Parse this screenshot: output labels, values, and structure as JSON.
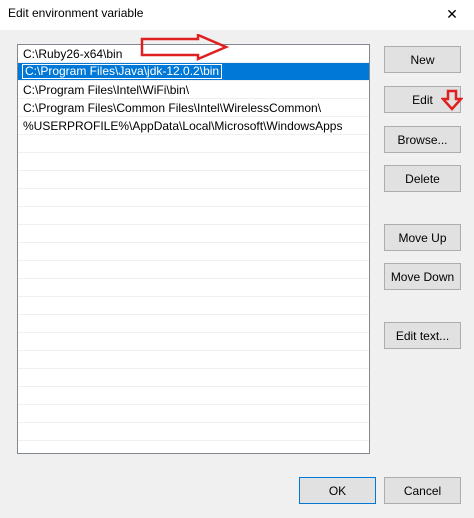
{
  "window": {
    "title": "Edit environment variable",
    "close_glyph": "✕"
  },
  "list": {
    "items": [
      "C:\\Ruby26-x64\\bin",
      "C:\\Program Files\\Java\\jdk-12.0.2\\bin",
      "C:\\Program Files\\Intel\\WiFi\\bin\\",
      "C:\\Program Files\\Common Files\\Intel\\WirelessCommon\\",
      "%USERPROFILE%\\AppData\\Local\\Microsoft\\WindowsApps"
    ],
    "selected_index": 1,
    "selection_color": "#0078d7"
  },
  "buttons": {
    "new": "New",
    "edit": "Edit",
    "browse": "Browse...",
    "delete": "Delete",
    "move_up": "Move Up",
    "move_down": "Move Down",
    "edit_text": "Edit text...",
    "ok": "OK",
    "cancel": "Cancel"
  },
  "annotations": {
    "arrow_color": "#e02020"
  }
}
